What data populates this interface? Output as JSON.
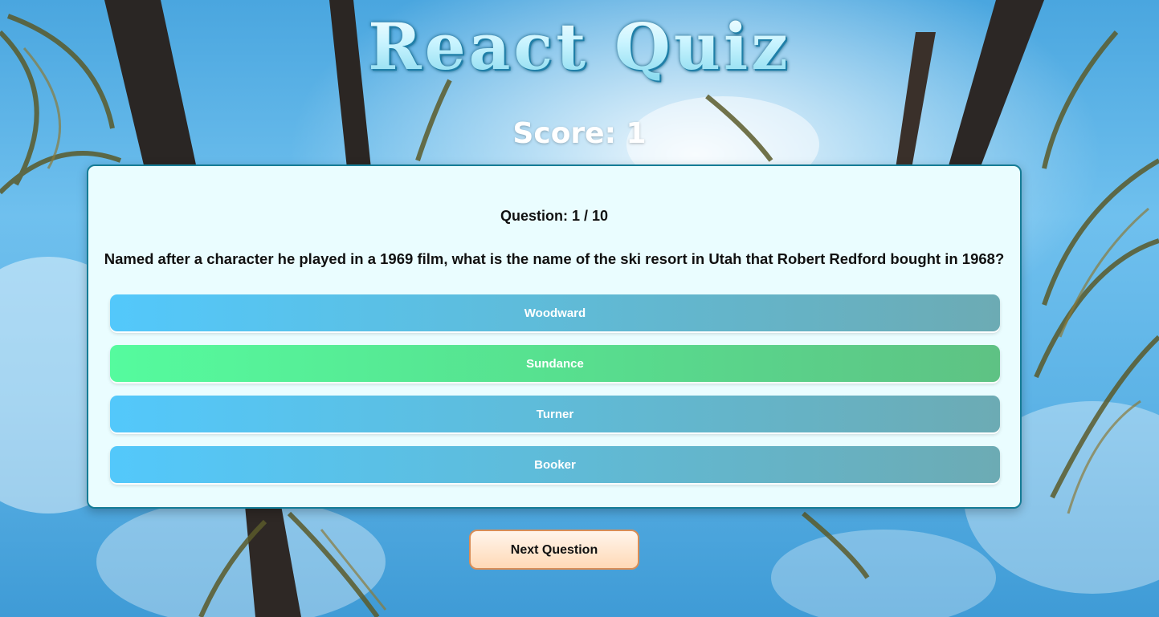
{
  "header": {
    "title": "React Quiz",
    "score_text": "Score: 1"
  },
  "quiz": {
    "question_counter": "Question: 1 / 10",
    "question_text": "Named after a character he played in a 1969 film, what is the name of the ski resort in Utah that Robert Redford bought in 1968?",
    "answers": [
      {
        "label": "Woodward",
        "state": "default"
      },
      {
        "label": "Sundance",
        "state": "correct"
      },
      {
        "label": "Turner",
        "state": "default"
      },
      {
        "label": "Booker",
        "state": "default"
      }
    ]
  },
  "controls": {
    "next_label": "Next Question"
  },
  "colors": {
    "answer_default": "#53c8fb",
    "answer_correct": "#55fb9e",
    "card_background": "#eafdff",
    "card_border": "#157c96",
    "next_button": "#ffd9b6"
  }
}
